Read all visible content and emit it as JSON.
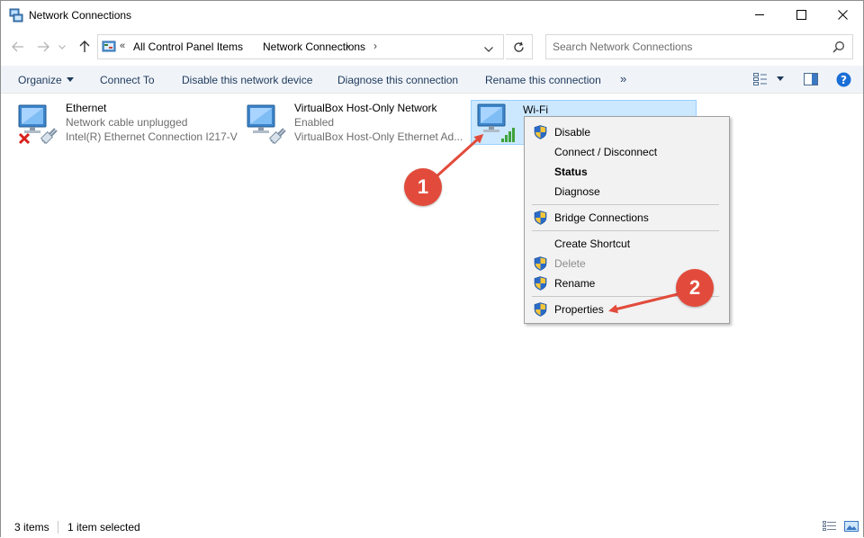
{
  "window": {
    "title": "Network Connections",
    "app_icon": "network-connections-icon"
  },
  "address": {
    "prefix": "«",
    "crumbs": [
      "All Control Panel Items",
      "Network Connections"
    ],
    "separator": "›"
  },
  "search": {
    "placeholder": "Search Network Connections",
    "value": ""
  },
  "commands": {
    "organize": "Organize",
    "connect_to": "Connect To",
    "disable_device": "Disable this network device",
    "diagnose": "Diagnose this connection",
    "rename": "Rename this connection",
    "more": "»"
  },
  "connections": [
    {
      "name": "Ethernet",
      "status": "Network cable unplugged",
      "device": "Intel(R) Ethernet Connection I217-V",
      "icon": "ethernet-disconnected-icon"
    },
    {
      "name": "VirtualBox Host-Only Network",
      "status": "Enabled",
      "device": "VirtualBox Host-Only Ethernet Ad...",
      "icon": "ethernet-adapter-icon"
    },
    {
      "name": "Wi-Fi",
      "status": "",
      "device": "",
      "icon": "wifi-adapter-icon",
      "selected": true
    }
  ],
  "context_menu": {
    "disable": "Disable",
    "connect_disconnect": "Connect / Disconnect",
    "status": "Status",
    "diagnose": "Diagnose",
    "bridge": "Bridge Connections",
    "create_shortcut": "Create Shortcut",
    "delete": "Delete",
    "rename": "Rename",
    "properties": "Properties"
  },
  "annotations": {
    "step1": "1",
    "step2": "2",
    "color": "#e24b3b"
  },
  "statusbar": {
    "items_count": "3 items",
    "selected": "1 item selected"
  },
  "colors": {
    "selection_bg": "#cce8ff",
    "selection_border": "#99d1ff",
    "command_text": "#1e395b",
    "command_bar_bg": "#f0f4f9",
    "help_blue": "#1a6fd6"
  }
}
